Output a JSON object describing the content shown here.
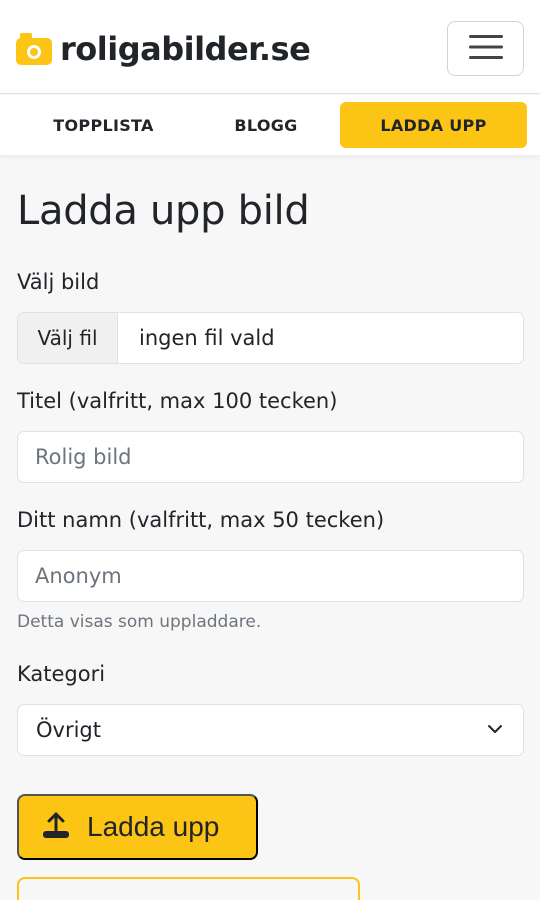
{
  "header": {
    "logo_text": "roligabilder.se",
    "menu_icon": "hamburger-menu-icon",
    "logo_icon": "camera-icon"
  },
  "nav": {
    "items": [
      {
        "label": "TOPPLISTA"
      },
      {
        "label": "BLOGG"
      },
      {
        "label": "LADDA UPP"
      }
    ],
    "active_index": 2
  },
  "page": {
    "title": "Ladda upp bild"
  },
  "form": {
    "image": {
      "label": "Välj bild",
      "button_label": "Välj fil",
      "file_value": "ingen fil vald"
    },
    "title": {
      "label": "Titel (valfritt, max 100 tecken)",
      "placeholder": "Rolig bild"
    },
    "name": {
      "label": "Ditt namn (valfritt, max 50 tecken)",
      "placeholder": "Anonym",
      "help": "Detta visas som uppladdare."
    },
    "category": {
      "label": "Kategori",
      "selected": "Övrigt"
    },
    "submit_label": "Ladda upp",
    "submit_icon": "upload-icon"
  },
  "colors": {
    "accent": "#fcc414",
    "text": "#212529",
    "muted": "#6c757d",
    "border": "#dee2e6",
    "background": "#f7f7f7"
  }
}
